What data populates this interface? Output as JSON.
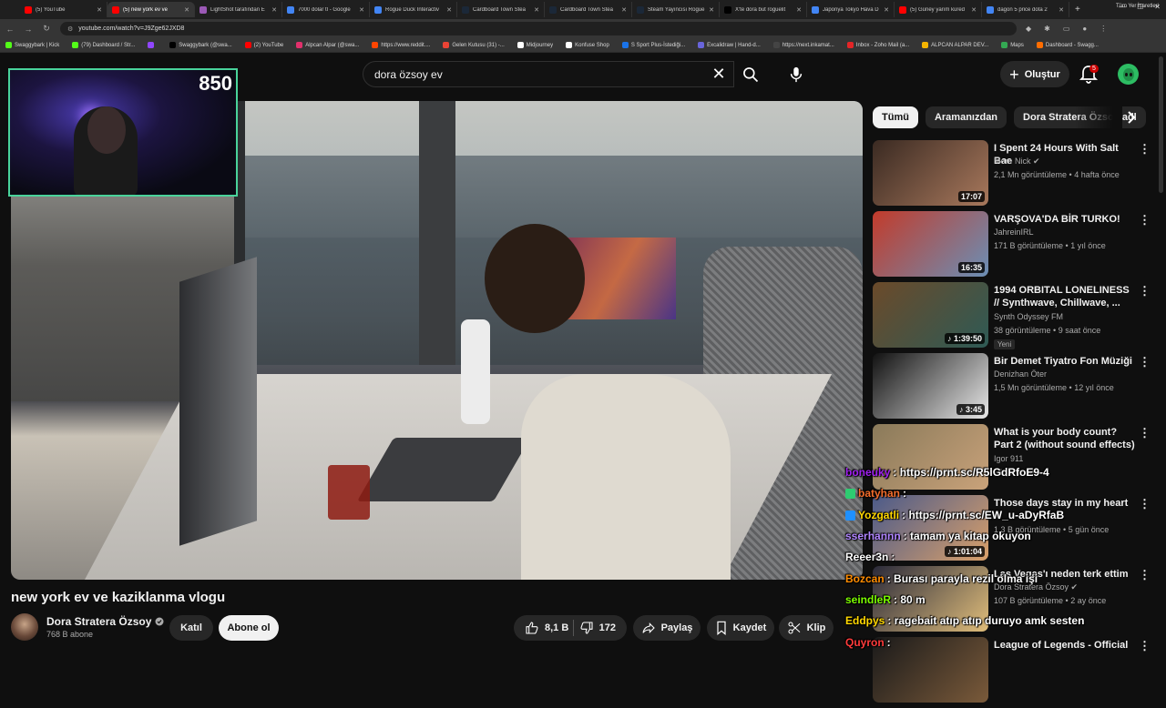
{
  "browser": {
    "tabs": [
      {
        "label": "(5) YouTube",
        "color": "#ff0000",
        "active": false
      },
      {
        "label": "(5) new york ev ve",
        "color": "#ff0000",
        "active": true
      },
      {
        "label": "LightShot tarafından E",
        "color": "#9b59b6",
        "active": false
      },
      {
        "label": "7000 dolar tl - Google",
        "color": "#4285f4",
        "active": false
      },
      {
        "label": "Rogue Duck Interactiv",
        "color": "#4285f4",
        "active": false
      },
      {
        "label": "Cardboard Town Stea",
        "color": "#1b2838",
        "active": false
      },
      {
        "label": "Cardboard Town Stea",
        "color": "#1b2838",
        "active": false
      },
      {
        "label": "Steam Yayıncısı Rogue",
        "color": "#1b2838",
        "active": false
      },
      {
        "label": "X'te dora but roguelit",
        "color": "#000000",
        "active": false
      },
      {
        "label": "Japonya Tokyo Hava D",
        "color": "#4285f4",
        "active": false
      },
      {
        "label": "(5) Güney yarım küred",
        "color": "#ff0000",
        "active": false
      },
      {
        "label": "dagon 5 price dota 2",
        "color": "#4285f4",
        "active": false
      }
    ],
    "url": "youtube.com/watch?v=J9Zge62JXD8",
    "bookmarks": [
      {
        "label": "Swaggybark | Kick",
        "color": "#53fc18"
      },
      {
        "label": "(79) Dashboard / Str...",
        "color": "#53fc18"
      },
      {
        "label": "",
        "color": "#9146ff"
      },
      {
        "label": "Swaggybark (@swa...",
        "color": "#000000"
      },
      {
        "label": "(2) YouTube",
        "color": "#ff0000"
      },
      {
        "label": "Alpcan Alpar (@swa...",
        "color": "#e1306c"
      },
      {
        "label": "https://www.reddit....",
        "color": "#ff4500"
      },
      {
        "label": "Gelen Kutusu (31) -...",
        "color": "#ea4335"
      },
      {
        "label": "Midjourney",
        "color": "#ffffff"
      },
      {
        "label": "Konfuse Shop",
        "color": "#ffffff"
      },
      {
        "label": "S Sport Plus-İstediği...",
        "color": "#1a73e8"
      },
      {
        "label": "Excalidraw | Hand-d...",
        "color": "#6965db"
      },
      {
        "label": "https://next.inkamat...",
        "color": "#444444"
      },
      {
        "label": "Inbox - Zoho Mail (a...",
        "color": "#e42527"
      },
      {
        "label": "ALPCAN ALPAR DEV...",
        "color": "#f4b400"
      },
      {
        "label": "Maps",
        "color": "#34a853"
      },
      {
        "label": "Dashboard - Swagg...",
        "color": "#ff6d00"
      }
    ],
    "all_bookmarks": "Tüm Yer İşaretleri"
  },
  "header": {
    "search_value": "dora özsoy ev",
    "create_label": "Oluştur",
    "notification_count": "5"
  },
  "webcam": {
    "viewer_count": "850"
  },
  "video": {
    "title": "new york ev ve kaziklanma vlogu",
    "channel_name": "Dora Stratera Özsoy",
    "subscribers": "768 B abone",
    "join_label": "Katıl",
    "subscribe_label": "Abone ol",
    "likes": "8,1 B",
    "dislikes": "172",
    "share_label": "Paylaş",
    "save_label": "Kaydet",
    "clip_label": "Klip"
  },
  "chips": [
    {
      "label": "Tümü",
      "active": true
    },
    {
      "label": "Aramanızdan",
      "active": false
    },
    {
      "label": "Dora Stratera Özsoy adl",
      "active": false
    }
  ],
  "recommendations": [
    {
      "title": "I Spent 24 Hours With Salt Bae",
      "channel": "More Nick",
      "verified": true,
      "meta": "2,1 Mn görüntüleme • 4 hafta önce",
      "duration": "17:07",
      "thumb": [
        "#3a2a22",
        "#a8785c"
      ],
      "badge": "",
      "music": false
    },
    {
      "title": "VARŞOVA'DA BİR TURKO!",
      "channel": "JahreinIRL",
      "verified": false,
      "meta": "171 B görüntüleme • 1 yıl önce",
      "duration": "16:35",
      "thumb": [
        "#c23b2b",
        "#6b8fb5"
      ],
      "badge": "",
      "music": false
    },
    {
      "title": "1994 ORBITAL LONELINESS // Synthwave, Chillwave, ...",
      "channel": "Synth Odyssey FM",
      "verified": false,
      "meta": "38 görüntüleme • 9 saat önce",
      "duration": "1:39:50",
      "thumb": [
        "#6b4a2a",
        "#2e5a55"
      ],
      "badge": "Yeni",
      "music": true
    },
    {
      "title": "Bir Demet Tiyatro Fon Müziği",
      "channel": "Denizhan Öter",
      "verified": false,
      "meta": "1,5 Mn görüntüleme • 12 yıl önce",
      "duration": "3:45",
      "thumb": [
        "#111111",
        "#e8e8e8"
      ],
      "badge": "",
      "music": true
    },
    {
      "title": "What is your body count? Part 2 (without sound effects)",
      "channel": "Igor 911",
      "verified": false,
      "meta": "• 1 yıl önce",
      "duration": "",
      "thumb": [
        "#8a7a5a",
        "#c9a27a"
      ],
      "badge": "",
      "music": false
    },
    {
      "title": "Those days stay in my heart",
      "channel": "",
      "verified": false,
      "meta": "1,3 B görüntüleme • 5 gün önce",
      "duration": "1:01:04",
      "thumb": [
        "#4b5a8a",
        "#d9a06a"
      ],
      "badge": "",
      "music": true
    },
    {
      "title": "Las Vegas'ı neden terk ettim",
      "channel": "Dora Stratera Özsoy",
      "verified": true,
      "meta": "107 B görüntüleme • 2 ay önce",
      "duration": "",
      "thumb": [
        "#2a2a3a",
        "#e0bd7a"
      ],
      "badge": "",
      "music": false
    },
    {
      "title": "League of Legends - Official",
      "channel": "",
      "verified": false,
      "meta": "",
      "duration": "",
      "thumb": [
        "#1a1a1a",
        "#7a5a3a"
      ],
      "badge": "",
      "music": false
    }
  ],
  "chat": [
    {
      "user": "boneuky",
      "user_color": "#a020f0",
      "text": "https://prnt.sc/R5lGdRfoE9-4",
      "badge_color": ""
    },
    {
      "user": "batyhan",
      "user_color": "#f26c2b",
      "text": "",
      "badge_color": "#2ecc71"
    },
    {
      "user": "Yozgatli",
      "user_color": "#ffd700",
      "text": "https://prnt.sc/EW_u-aDyRfaB",
      "badge_color": "#1e90ff"
    },
    {
      "user": "sserhannn",
      "user_color": "#b084ff",
      "text": "tamam ya kitap okuyon",
      "badge_color": ""
    },
    {
      "user": "Reeer3n",
      "user_color": "#ffffff",
      "text": "",
      "badge_color": ""
    },
    {
      "user": "Bozcan",
      "user_color": "#ff8c00",
      "text": "Burası parayla rezil olma işi",
      "badge_color": ""
    },
    {
      "user": "seindleR",
      "user_color": "#7cfc00",
      "text": "80 m",
      "badge_color": ""
    },
    {
      "user": "Eddpys",
      "user_color": "#ffd700",
      "text": "ragebait atıp atıp duruyo amk sesten",
      "badge_color": ""
    },
    {
      "user": "Quyron",
      "user_color": "#ff3b3b",
      "text": "",
      "badge_color": ""
    }
  ]
}
